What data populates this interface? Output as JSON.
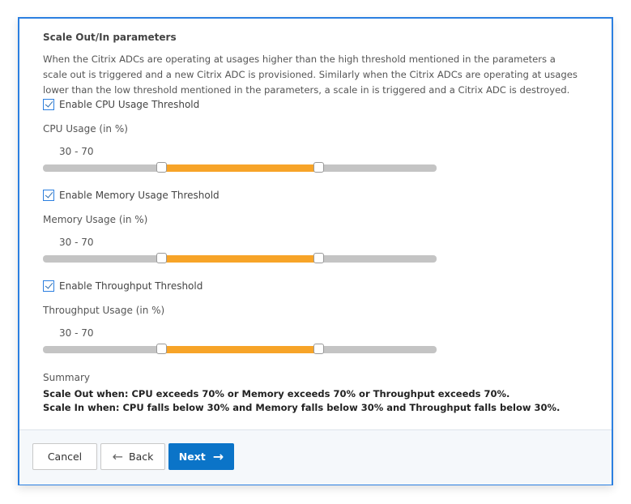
{
  "section_title": "Scale Out/In parameters",
  "description": "When the Citrix ADCs are operating at usages higher than the high threshold mentioned in the parameters a scale out is triggered and a new Citrix ADC is provisioned. Similarly when the Citrix ADCs are operating at usages lower than the low threshold mentioned in the parameters, a scale in is triggered and a Citrix ADC is destroyed.",
  "thresholds": [
    {
      "checkbox": "Enable CPU Usage Threshold",
      "checked": true,
      "label": "CPU Usage (in %)",
      "value_text": "30 - 70",
      "low": 30,
      "high": 70
    },
    {
      "checkbox": "Enable Memory Usage Threshold",
      "checked": true,
      "label": "Memory Usage (in %)",
      "value_text": "30 - 70",
      "low": 30,
      "high": 70
    },
    {
      "checkbox": "Enable Throughput Threshold",
      "checked": true,
      "label": "Throughput Usage (in %)",
      "value_text": "30 - 70",
      "low": 30,
      "high": 70
    }
  ],
  "summary": {
    "title": "Summary",
    "scale_out": "Scale Out when: CPU exceeds 70% or Memory exceeds 70% or Throughput exceeds 70%.",
    "scale_in": "Scale In when: CPU falls below 30% and Memory falls below 30% and Throughput falls below 30%."
  },
  "buttons": {
    "cancel": "Cancel",
    "back": "Back",
    "next": "Next"
  },
  "colors": {
    "accent": "#0b74c8",
    "slider_fill": "#f7a428",
    "frame": "#2b7fe0"
  }
}
